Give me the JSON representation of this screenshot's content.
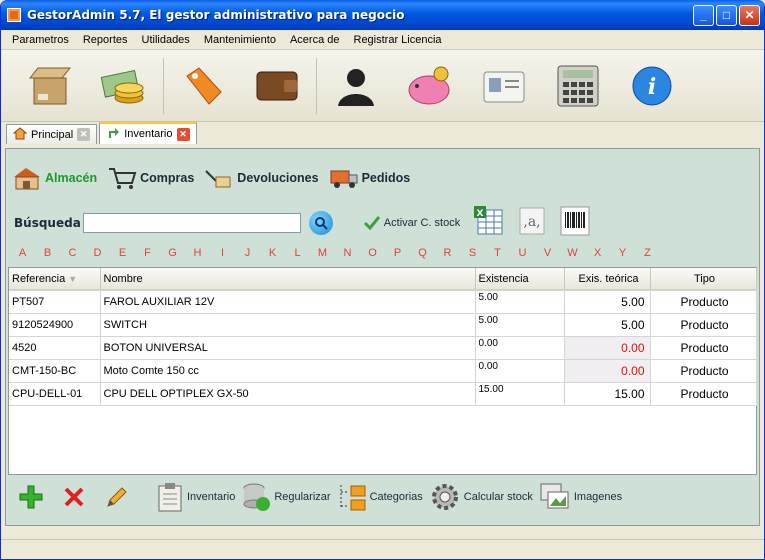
{
  "window": {
    "title": "GestorAdmin 5.7,  El gestor administrativo para negocio",
    "min": "_",
    "max": "□",
    "close": "✕"
  },
  "menu": [
    "Parametros",
    "Reportes",
    "Utilidades",
    "Mantenimiento",
    "Acerca de",
    "Registrar Licencia"
  ],
  "tabs": [
    {
      "label": "Principal"
    },
    {
      "label": "Inventario"
    }
  ],
  "sections": [
    "Almacén",
    "Compras",
    "Devoluciones",
    "Pedidos"
  ],
  "search": {
    "label": "Búsqueda",
    "value": "",
    "check_label": "Activar C. stock"
  },
  "alphabet": [
    "A",
    "B",
    "C",
    "D",
    "E",
    "F",
    "G",
    "H",
    "I",
    "J",
    "K",
    "L",
    "M",
    "N",
    "O",
    "P",
    "Q",
    "R",
    "S",
    "T",
    "U",
    "V",
    "W",
    "X",
    "Y",
    "Z"
  ],
  "table": {
    "columns": [
      "Referencia",
      "Nombre",
      "Existencia",
      "Exis. teórica",
      "Tipo"
    ],
    "rows": [
      [
        "PT507",
        "FAROL AUXILIAR 12V",
        "5.00",
        "5.00",
        "Producto"
      ],
      [
        "9120524900",
        "SWITCH",
        "5.00",
        "5.00",
        "Producto"
      ],
      [
        "4520",
        "BOTON UNIVERSAL",
        "0.00",
        "0.00",
        "Producto"
      ],
      [
        "CMT-150-BC",
        "Moto Comte 150 cc",
        "0.00",
        "0.00",
        "Producto"
      ],
      [
        "CPU-DELL-01",
        "CPU DELL OPTIPLEX GX-50",
        "15.00",
        "15.00",
        "Producto"
      ]
    ]
  },
  "bottom": [
    "Inventario",
    "Regularizar",
    "Categorias",
    "Calcular stock",
    "Imagenes"
  ],
  "colors": {
    "active_section": "#1a9a2a",
    "panel_bg": "#cfe0d6",
    "negative": "#e01010"
  }
}
